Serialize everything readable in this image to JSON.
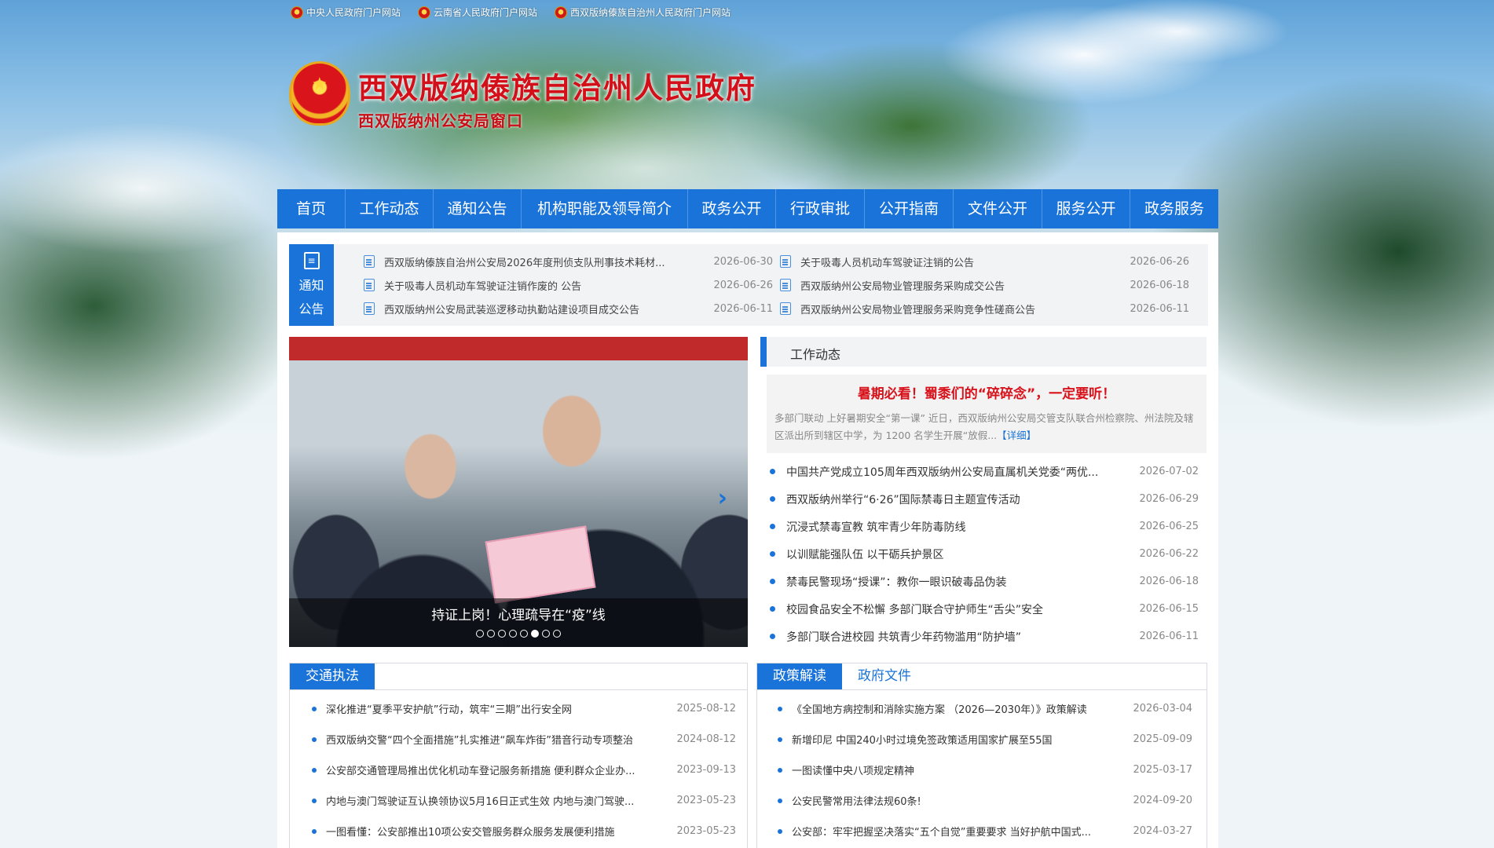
{
  "top_links": [
    {
      "label": "中央人民政府门户网站"
    },
    {
      "label": "云南省人民政府门户网站"
    },
    {
      "label": "西双版纳傣族自治州人民政府门户网站"
    }
  ],
  "header": {
    "title": "西双版纳傣族自治州人民政府",
    "subtitle": "西双版纳州公安局窗口"
  },
  "nav": [
    {
      "label": "首页"
    },
    {
      "label": "工作动态"
    },
    {
      "label": "通知公告"
    },
    {
      "label": "机构职能及领导简介"
    },
    {
      "label": "政务公开"
    },
    {
      "label": "行政审批"
    },
    {
      "label": "公开指南"
    },
    {
      "label": "文件公开"
    },
    {
      "label": "服务公开"
    },
    {
      "label": "政务服务"
    }
  ],
  "notice": {
    "tag_line1": "通知",
    "tag_line2": "公告",
    "items": [
      {
        "title": "西双版纳傣族自治州公安局2026年度刑侦支队刑事技术耗材...",
        "date": "2026-06-30"
      },
      {
        "title": "关于吸毒人员机动车驾驶证注销的公告",
        "date": "2026-06-26"
      },
      {
        "title": "关于吸毒人员机动车驾驶证注销作废的 公告",
        "date": "2026-06-26"
      },
      {
        "title": "西双版纳州公安局物业管理服务采购成交公告",
        "date": "2026-06-18"
      },
      {
        "title": "西双版纳州公安局武装巡逻移动执勤站建设项目成交公告",
        "date": "2026-06-11"
      },
      {
        "title": "西双版纳州公安局物业管理服务采购竞争性磋商公告",
        "date": "2026-06-11"
      }
    ]
  },
  "carousel": {
    "caption": "持证上岗！心理疏导在“疫”线",
    "slide_count": 8,
    "active_index": 5
  },
  "work": {
    "heading": "工作动态",
    "headline": {
      "title": "暑期必看！蜀黍们的“碎碎念”，一定要听！",
      "summary": "多部门联动 上好暑期安全“第一课” 近日，西双版纳州公安局交管支队联合州检察院、州法院及辖区派出所到辖区中学，为 1200 名学生开展“放假...",
      "more": "【详细】"
    },
    "items": [
      {
        "title": "中国共产党成立105周年西双版纳州公安局直属机关党委“两优...",
        "date": "2026-07-02"
      },
      {
        "title": "西双版纳州举行“6·26”国际禁毒日主题宣传活动",
        "date": "2026-06-29"
      },
      {
        "title": "沉浸式禁毒宣教 筑牢青少年防毒防线",
        "date": "2026-06-25"
      },
      {
        "title": "以训赋能强队伍 以干砺兵护景区",
        "date": "2026-06-22"
      },
      {
        "title": "禁毒民警现场“授课”：教你一眼识破毒品伪装",
        "date": "2026-06-18"
      },
      {
        "title": "校园食品安全不松懈 多部门联合守护师生“舌尖”安全",
        "date": "2026-06-15"
      },
      {
        "title": "多部门联合进校园 共筑青少年药物滥用“防护墙”",
        "date": "2026-06-11"
      }
    ]
  },
  "traffic": {
    "tab": "交通执法",
    "items": [
      {
        "title": "深化推进“夏季平安护航”行动，筑牢“三期”出行安全网",
        "date": "2025-08-12"
      },
      {
        "title": "西双版纳交警“四个全面措施”扎实推进“飙车炸街”猎音行动专项整治",
        "date": "2024-08-12"
      },
      {
        "title": "公安部交通管理局推出优化机动车登记服务新措施 便利群众企业办...",
        "date": "2023-09-13"
      },
      {
        "title": "内地与澳门驾驶证互认换领协议5月16日正式生效 内地与澳门驾驶...",
        "date": "2023-05-23"
      },
      {
        "title": "一图看懂：公安部推出10项公安交管服务群众服务发展便利措施",
        "date": "2023-05-23"
      }
    ]
  },
  "policy": {
    "tab_active": "政策解读",
    "tab_other": "政府文件",
    "items": [
      {
        "title": "《全国地方病控制和消除实施方案 （2026—2030年）》政策解读",
        "date": "2026-03-04"
      },
      {
        "title": "新增印尼 中国240小时过境免签政策适用国家扩展至55国",
        "date": "2025-09-09"
      },
      {
        "title": "一图读懂中央八项规定精神",
        "date": "2025-03-17"
      },
      {
        "title": "公安民警常用法律法规60条!",
        "date": "2024-09-20"
      },
      {
        "title": "公安部：牢牢把握坚决落实“五个自觉”重要要求 当好护航中国式...",
        "date": "2024-03-27"
      }
    ]
  },
  "colors": {
    "brand_blue": "#1a73d8",
    "title_red": "#d3101a"
  }
}
